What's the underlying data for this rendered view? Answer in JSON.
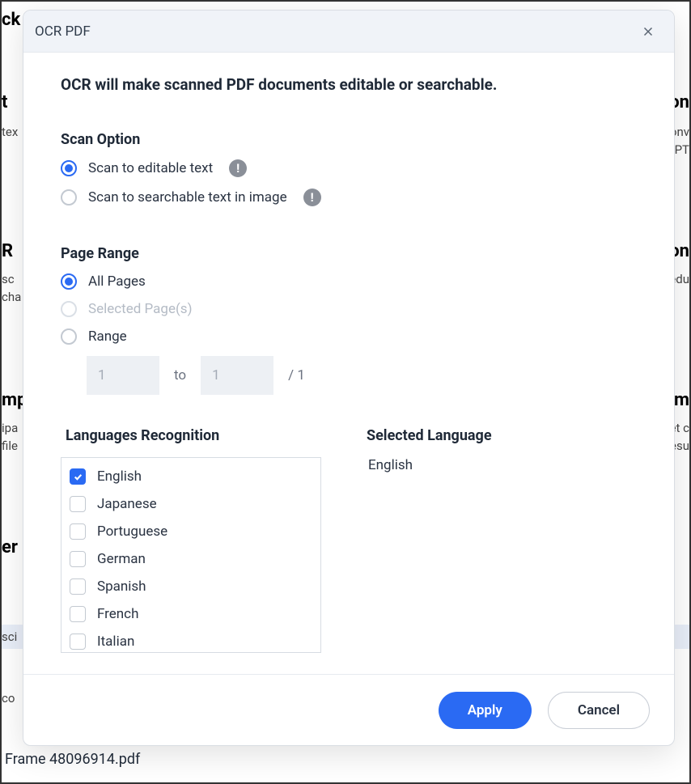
{
  "background": {
    "frag1": "ck",
    "fragR0": "R",
    "frag_t": "t",
    "frag_text": "tex",
    "fragR1a": "on",
    "fragR1b": "onv",
    "fragR1c": "PT,",
    "fragR2": "on",
    "frag_sc": "sc",
    "frag_cha": "cha",
    "fragR3": "edu",
    "frag_mp": "mp",
    "frag_ipa": "ipa",
    "frag_file": "file",
    "fragR4": "em",
    "fragR5a": "et c",
    "fragR5b": "esu",
    "frag_er": "er",
    "frag_sel": "sci",
    "frag_co": "co"
  },
  "modal": {
    "title": "OCR PDF",
    "desc": "OCR will make scanned PDF documents editable or searchable.",
    "scan": {
      "title": "Scan Option",
      "opt1": "Scan to editable text",
      "opt2": "Scan to searchable text in image"
    },
    "pageRange": {
      "title": "Page Range",
      "all": "All Pages",
      "selected": "Selected Page(s)",
      "range": "Range",
      "from": "1",
      "to_label": "to",
      "to": "1",
      "total": "/ 1"
    },
    "languages": {
      "title": "Languages Recognition",
      "items": [
        {
          "label": "English",
          "checked": true
        },
        {
          "label": "Japanese",
          "checked": false
        },
        {
          "label": "Portuguese",
          "checked": false
        },
        {
          "label": "German",
          "checked": false
        },
        {
          "label": "Spanish",
          "checked": false
        },
        {
          "label": "French",
          "checked": false
        },
        {
          "label": "Italian",
          "checked": false
        }
      ]
    },
    "selected": {
      "title": "Selected Language",
      "value": "English"
    },
    "buttons": {
      "apply": "Apply",
      "cancel": "Cancel"
    }
  },
  "filename": "Frame 48096914.pdf"
}
